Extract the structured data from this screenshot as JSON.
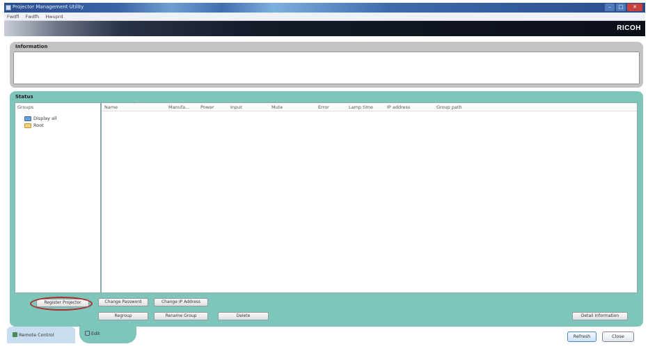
{
  "window": {
    "title": "Projector Management Utility",
    "buttons": [
      "–",
      "□",
      "✕"
    ]
  },
  "menu": [
    "Fwdfl",
    "Fwdfh",
    "Hwuprd"
  ],
  "brand": "RICOH",
  "information": {
    "title": "Information"
  },
  "status": {
    "title": "Status",
    "groups_label": "Groups",
    "tree": [
      "Display all",
      "Root"
    ],
    "columns": [
      "Name",
      "Manufa...",
      "Power",
      "Input",
      "Mute",
      "Error",
      "Lamp time",
      "IP address",
      "Group path"
    ]
  },
  "buttons": {
    "register": "Register Projector",
    "change_password": "Change Password",
    "change_ip": "Change IP Address",
    "regroup": "Regroup",
    "rename_group": "Rename Group",
    "delete": "Delete",
    "detail": "Detail Information"
  },
  "tabs": {
    "remote": "Remote Control",
    "edit": "Edit"
  },
  "footer": {
    "refresh": "Refresh",
    "close": "Close"
  },
  "colors": {
    "accent": "#7ec5bc",
    "info_panel": "#c2c4c6",
    "highlight": "#a8302c"
  },
  "icons": [
    "app-icon",
    "folder-blue-icon",
    "folder-yellow-icon",
    "remote-control-icon",
    "edit-icon"
  ]
}
